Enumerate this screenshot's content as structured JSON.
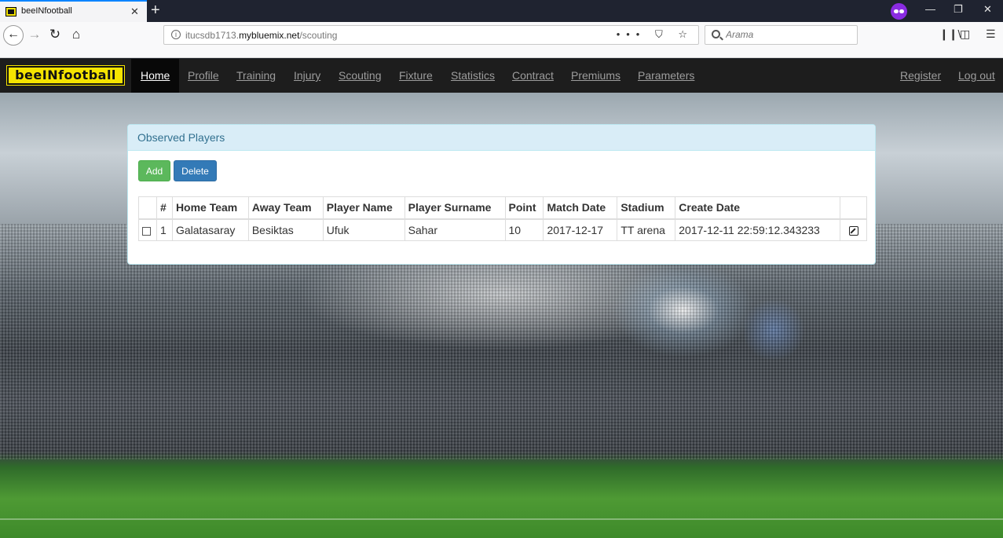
{
  "browser": {
    "tab_title": "beeINfootball",
    "tab_close": "✕",
    "new_tab": "+",
    "url_host": "itucsdb1713.",
    "url_domain": "mybluemix.net",
    "url_path": "/scouting",
    "url_actions": "••• ⛉ ☆",
    "search_placeholder": "Arama",
    "window_controls": {
      "minimize": "—",
      "restore": "❐",
      "close": "✕"
    },
    "icons": {
      "back": "arrow-left",
      "forward": "arrow-right",
      "reload": "reload",
      "home": "home",
      "library": "library",
      "sidebar": "sidebar",
      "menu": "hamburger"
    }
  },
  "site": {
    "logo": "beeINfootball",
    "nav": [
      "Home",
      "Profile",
      "Training",
      "Injury",
      "Scouting",
      "Fixture",
      "Statistics",
      "Contract",
      "Premiums",
      "Parameters"
    ],
    "active_nav": "Home",
    "register": "Register",
    "logout": "Log out"
  },
  "panel": {
    "title": "Observed Players",
    "add_label": "Add",
    "delete_label": "Delete"
  },
  "table": {
    "headers": [
      "",
      "#",
      "Home Team",
      "Away Team",
      "Player Name",
      "Player Surname",
      "Point",
      "Match Date",
      "Stadium",
      "Create Date",
      ""
    ],
    "rows": [
      {
        "num": "1",
        "home_team": "Galatasaray",
        "away_team": "Besiktas",
        "player_name": "Ufuk",
        "player_surname": "Sahar",
        "point": "10",
        "match_date": "2017-12-17",
        "stadium": "TT arena",
        "create_date": "2017-12-11 22:59:12.343233"
      }
    ]
  },
  "colors": {
    "accent": "#0a84ff",
    "logo_yellow": "#f5e400",
    "btn_green": "#5cb85c",
    "btn_blue": "#337ab7",
    "panel_heading": "#d9edf7"
  }
}
